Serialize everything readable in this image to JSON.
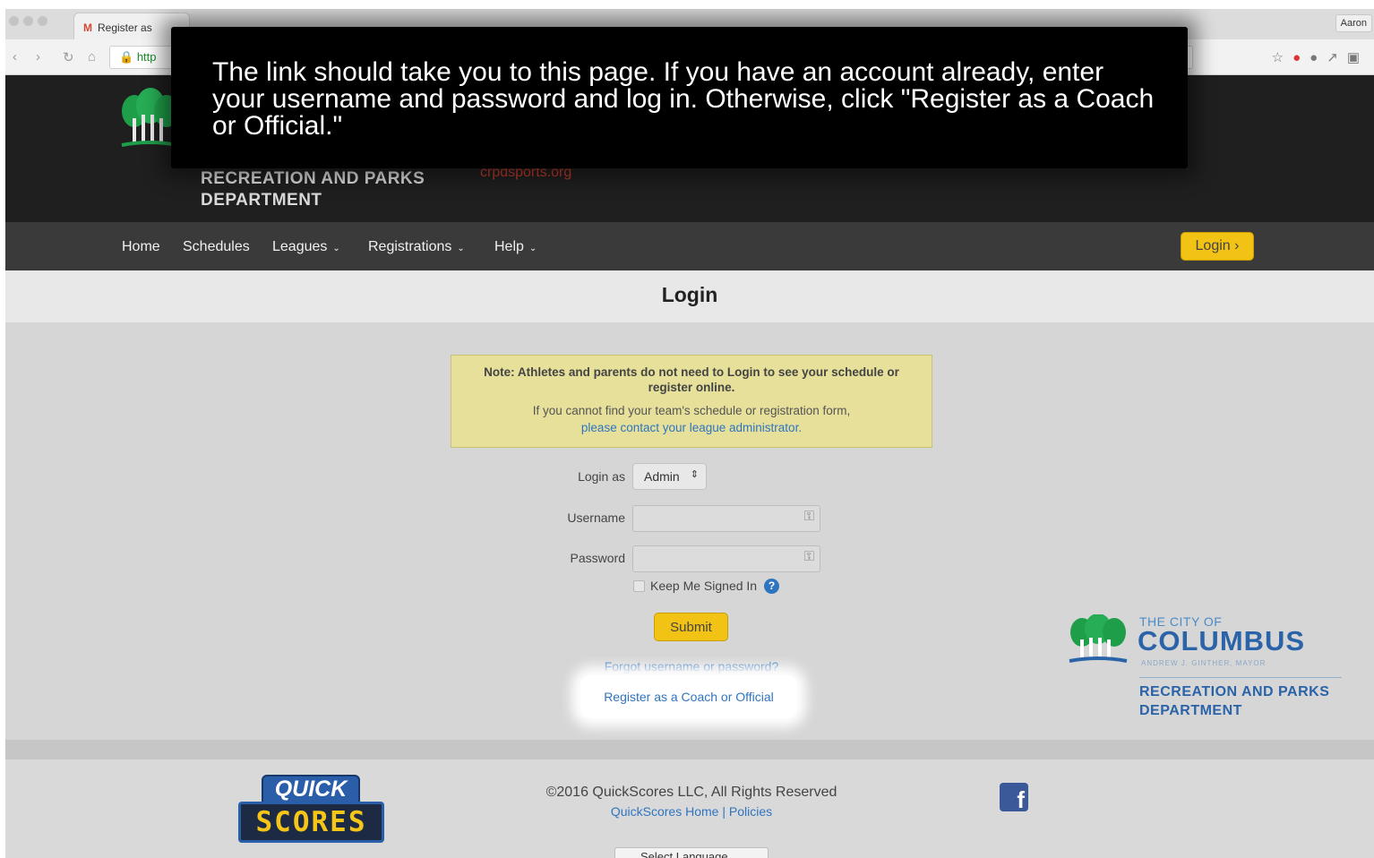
{
  "browser": {
    "tab_title": "Register as",
    "tab_icon": "gmail-m-icon",
    "url_partial": "http",
    "profile_name": "Aaron"
  },
  "site": {
    "department": "RECREATION AND PARKS DEPARTMENT",
    "site_link": "crpdsports.org"
  },
  "nav": {
    "items": [
      {
        "label": "Home"
      },
      {
        "label": "Schedules"
      },
      {
        "label": "Leagues"
      },
      {
        "label": "Registrations"
      },
      {
        "label": "Help"
      }
    ],
    "login_button": "Login ›"
  },
  "page": {
    "title": "Login",
    "note_bold": "Note: Athletes and parents do not need to Login to see your schedule or register online.",
    "note_text": "If you cannot find your team's schedule or registration form,",
    "note_link": "please contact your league administrator.",
    "login_as_label": "Login as",
    "login_as_value": "Admin",
    "username_label": "Username",
    "username_value": "",
    "password_label": "Password",
    "password_value": "",
    "keep_signed_in": "Keep Me Signed In",
    "submit_label": "Submit",
    "forgot_link": "Forgot username or password?",
    "register_link": "Register as a Coach or Official"
  },
  "columbus_logo": {
    "small": "THE CITY OF",
    "big": "COLUMBUS",
    "mayor": "ANDREW J. GINTHER, MAYOR",
    "department": "RECREATION AND PARKS DEPARTMENT"
  },
  "footer": {
    "logo_top": "QUICK",
    "logo_bottom": "SCORES",
    "copyright": "©2016 QuickScores LLC, All Rights Reserved",
    "link_home": "QuickScores Home",
    "separator": "|",
    "link_policies": "Policies",
    "language_select": "Select Language"
  },
  "overlay": {
    "caption": "The link should take you to this page. If you have an account already, enter your username and password and log in. Otherwise, click \"Register as a Coach or Official.\""
  },
  "colors": {
    "header_bg": "#1f1f1f",
    "nav_bg": "#3a3a3a",
    "accent_yellow": "#f2c314",
    "link_blue": "#2f74c0",
    "note_bg": "#e6e09a",
    "columbus_blue": "#2a63a8"
  }
}
